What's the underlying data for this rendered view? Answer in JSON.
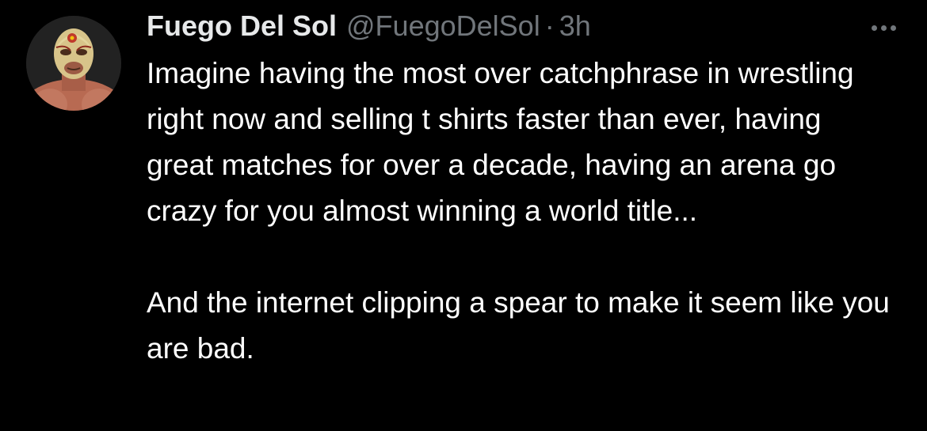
{
  "tweet": {
    "author": {
      "display_name": "Fuego Del Sol",
      "handle": "@FuegoDelSol",
      "avatar_icon": "masked-wrestler-avatar"
    },
    "separator": "·",
    "timestamp": "3h",
    "more_icon": "more-horizontal-icon",
    "body": {
      "paragraph_1": "Imagine having the most over catchphrase in wrestling right now and selling t shirts faster than ever, having great matches for over a decade, having an arena go crazy for you almost winning a world title...",
      "paragraph_2": "And the internet clipping a spear to make it seem like you are bad."
    }
  },
  "colors": {
    "background": "#000000",
    "primary_text": "#ffffff",
    "secondary_text": "#71767b"
  }
}
